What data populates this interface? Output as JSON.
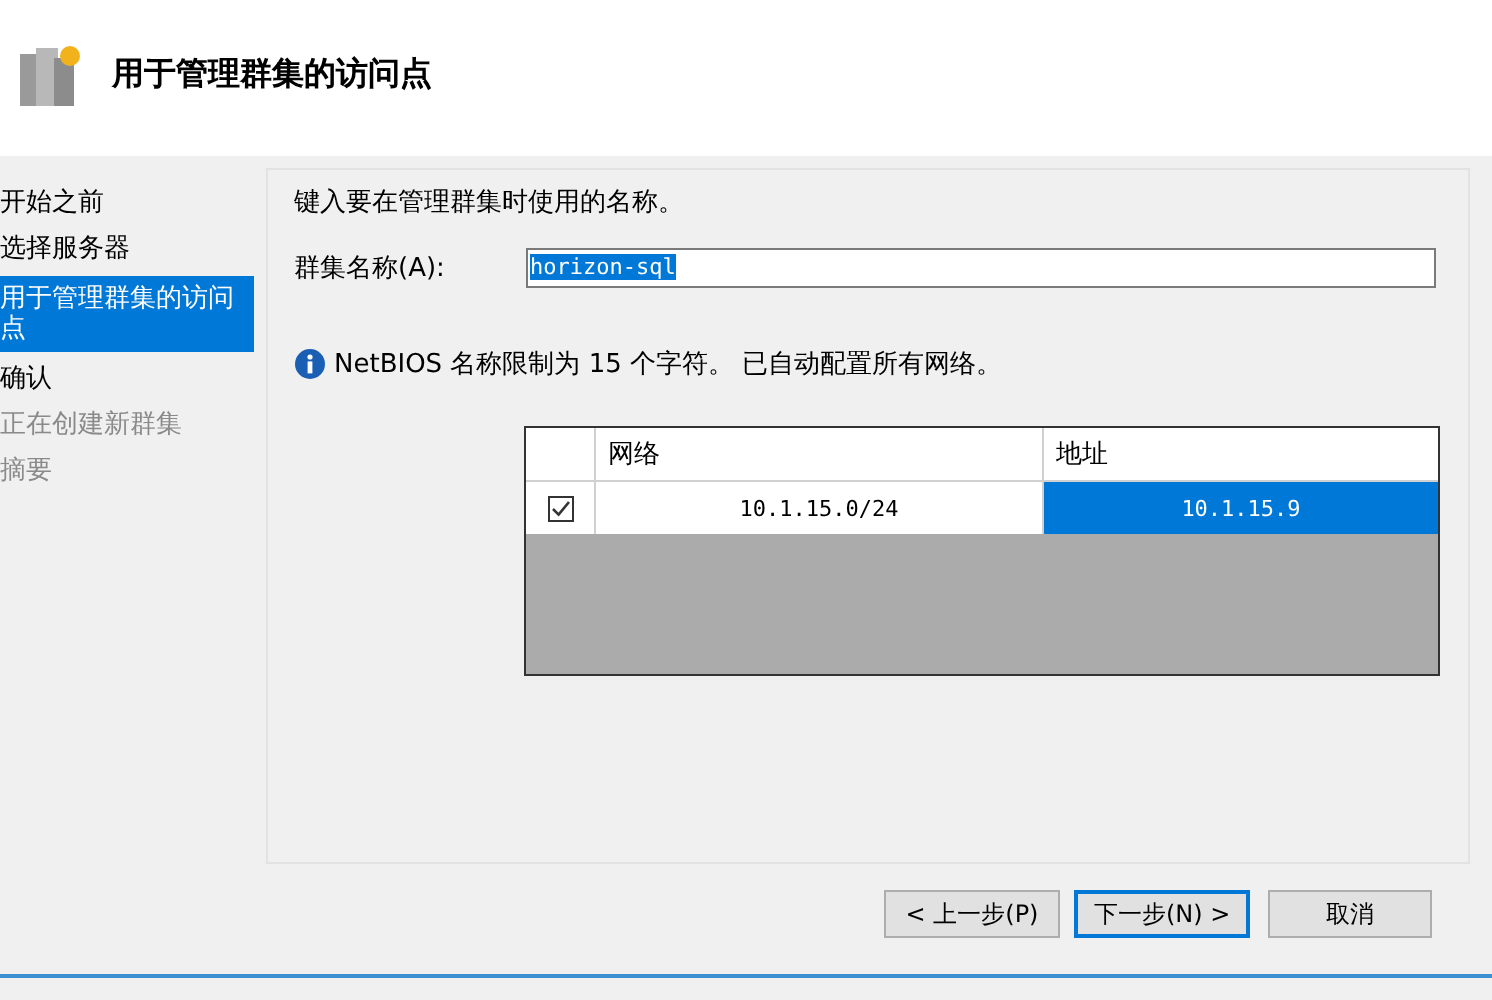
{
  "header": {
    "title": "用于管理群集的访问点"
  },
  "steps": [
    {
      "label": "开始之前",
      "selected": false,
      "disabled": false
    },
    {
      "label": "选择服务器",
      "selected": false,
      "disabled": false
    },
    {
      "label": "用于管理群集的访问点",
      "selected": true,
      "disabled": false
    },
    {
      "label": "确认",
      "selected": false,
      "disabled": false
    },
    {
      "label": "正在创建新群集",
      "selected": false,
      "disabled": true
    },
    {
      "label": "摘要",
      "selected": false,
      "disabled": true
    }
  ],
  "prompt": "键入要在管理群集时使用的名称。",
  "name_field": {
    "label": "群集名称(A):",
    "value": "horizon-sql"
  },
  "info": "NetBIOS 名称限制为 15 个字符。 已自动配置所有网络。",
  "networks": {
    "columns": [
      "网络",
      "地址"
    ],
    "rows": [
      {
        "checked": true,
        "network": "10.1.15.0/24",
        "address": "10.1.15.9",
        "selected": true
      }
    ]
  },
  "buttons": [
    {
      "label": "< 上一步(P)",
      "default": false
    },
    {
      "label": "下一步(N) >",
      "default": true
    },
    {
      "label": "取消",
      "default": false
    }
  ]
}
